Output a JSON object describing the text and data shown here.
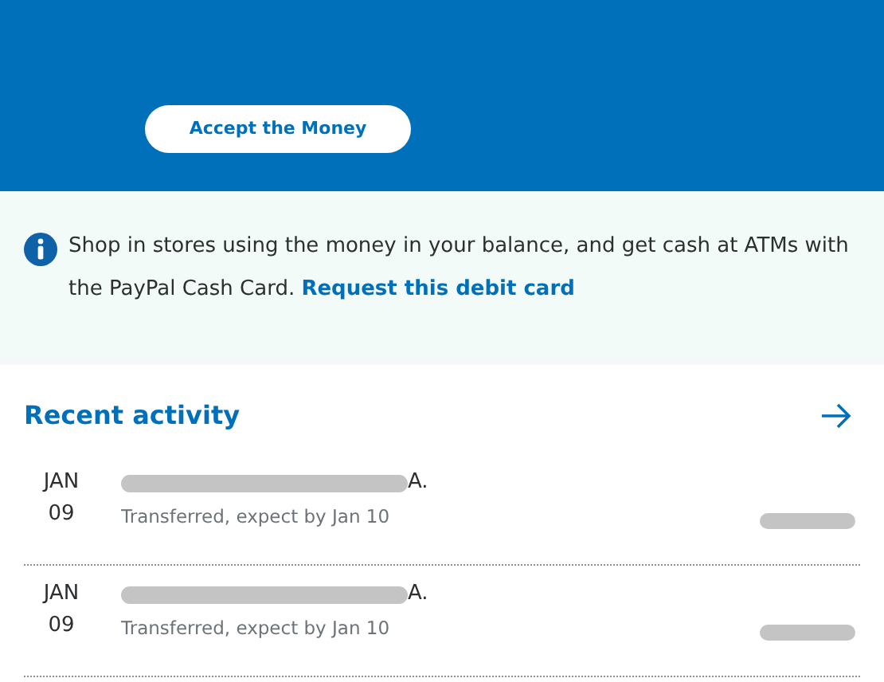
{
  "accept_button": {
    "label": "Accept the Money"
  },
  "info": {
    "text": "Shop in stores using the money in your balance, and get cash at ATMs with the PayPal Cash Card.",
    "link": "Request this debit card"
  },
  "recent_activity": {
    "title": "Recent activity",
    "items": [
      {
        "month": "JAN",
        "day": "09",
        "name_tail": "A.",
        "status": "Transferred, expect by Jan 10"
      },
      {
        "month": "JAN",
        "day": "09",
        "name_tail": "A.",
        "status": "Transferred, expect by Jan 10"
      }
    ]
  }
}
